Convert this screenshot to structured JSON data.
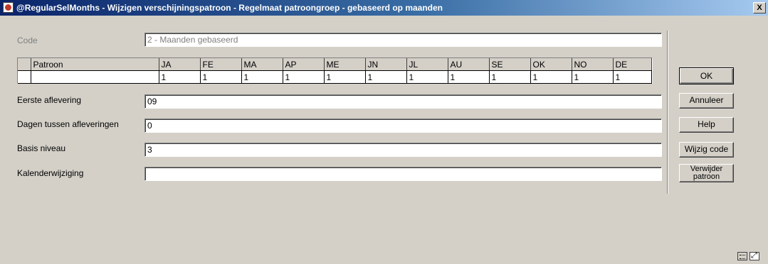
{
  "window": {
    "title": "@RegularSelMonths - Wijzigen verschijningspatroon - Regelmaat patroongroep - gebaseerd op maanden",
    "close_label": "X"
  },
  "form": {
    "code": {
      "label": "Code",
      "value": "2 - Maanden gebaseerd"
    },
    "first_issue": {
      "label": "Eerste aflevering",
      "value": "09"
    },
    "days_between": {
      "label": "Dagen tussen afleveringen",
      "value": "0"
    },
    "base_level": {
      "label": "Basis niveau",
      "value": "3"
    },
    "calendar_change": {
      "label": "Kalenderwijziging",
      "value": ""
    }
  },
  "grid": {
    "columns": [
      "Patroon",
      "JA",
      "FE",
      "MA",
      "AP",
      "ME",
      "JN",
      "JL",
      "AU",
      "SE",
      "OK",
      "NO",
      "DE"
    ],
    "row": [
      "",
      "1",
      "1",
      "1",
      "1",
      "1",
      "1",
      "1",
      "1",
      "1",
      "1",
      "1",
      "1"
    ]
  },
  "buttons": {
    "ok": "OK",
    "cancel": "Annuleer",
    "help": "Help",
    "change_code": "Wijzig code",
    "delete_pattern_line1": "Verwijder",
    "delete_pattern_line2": "patroon"
  },
  "icons": [
    "app-icon",
    "keyboard-icon",
    "maximize-icon"
  ]
}
